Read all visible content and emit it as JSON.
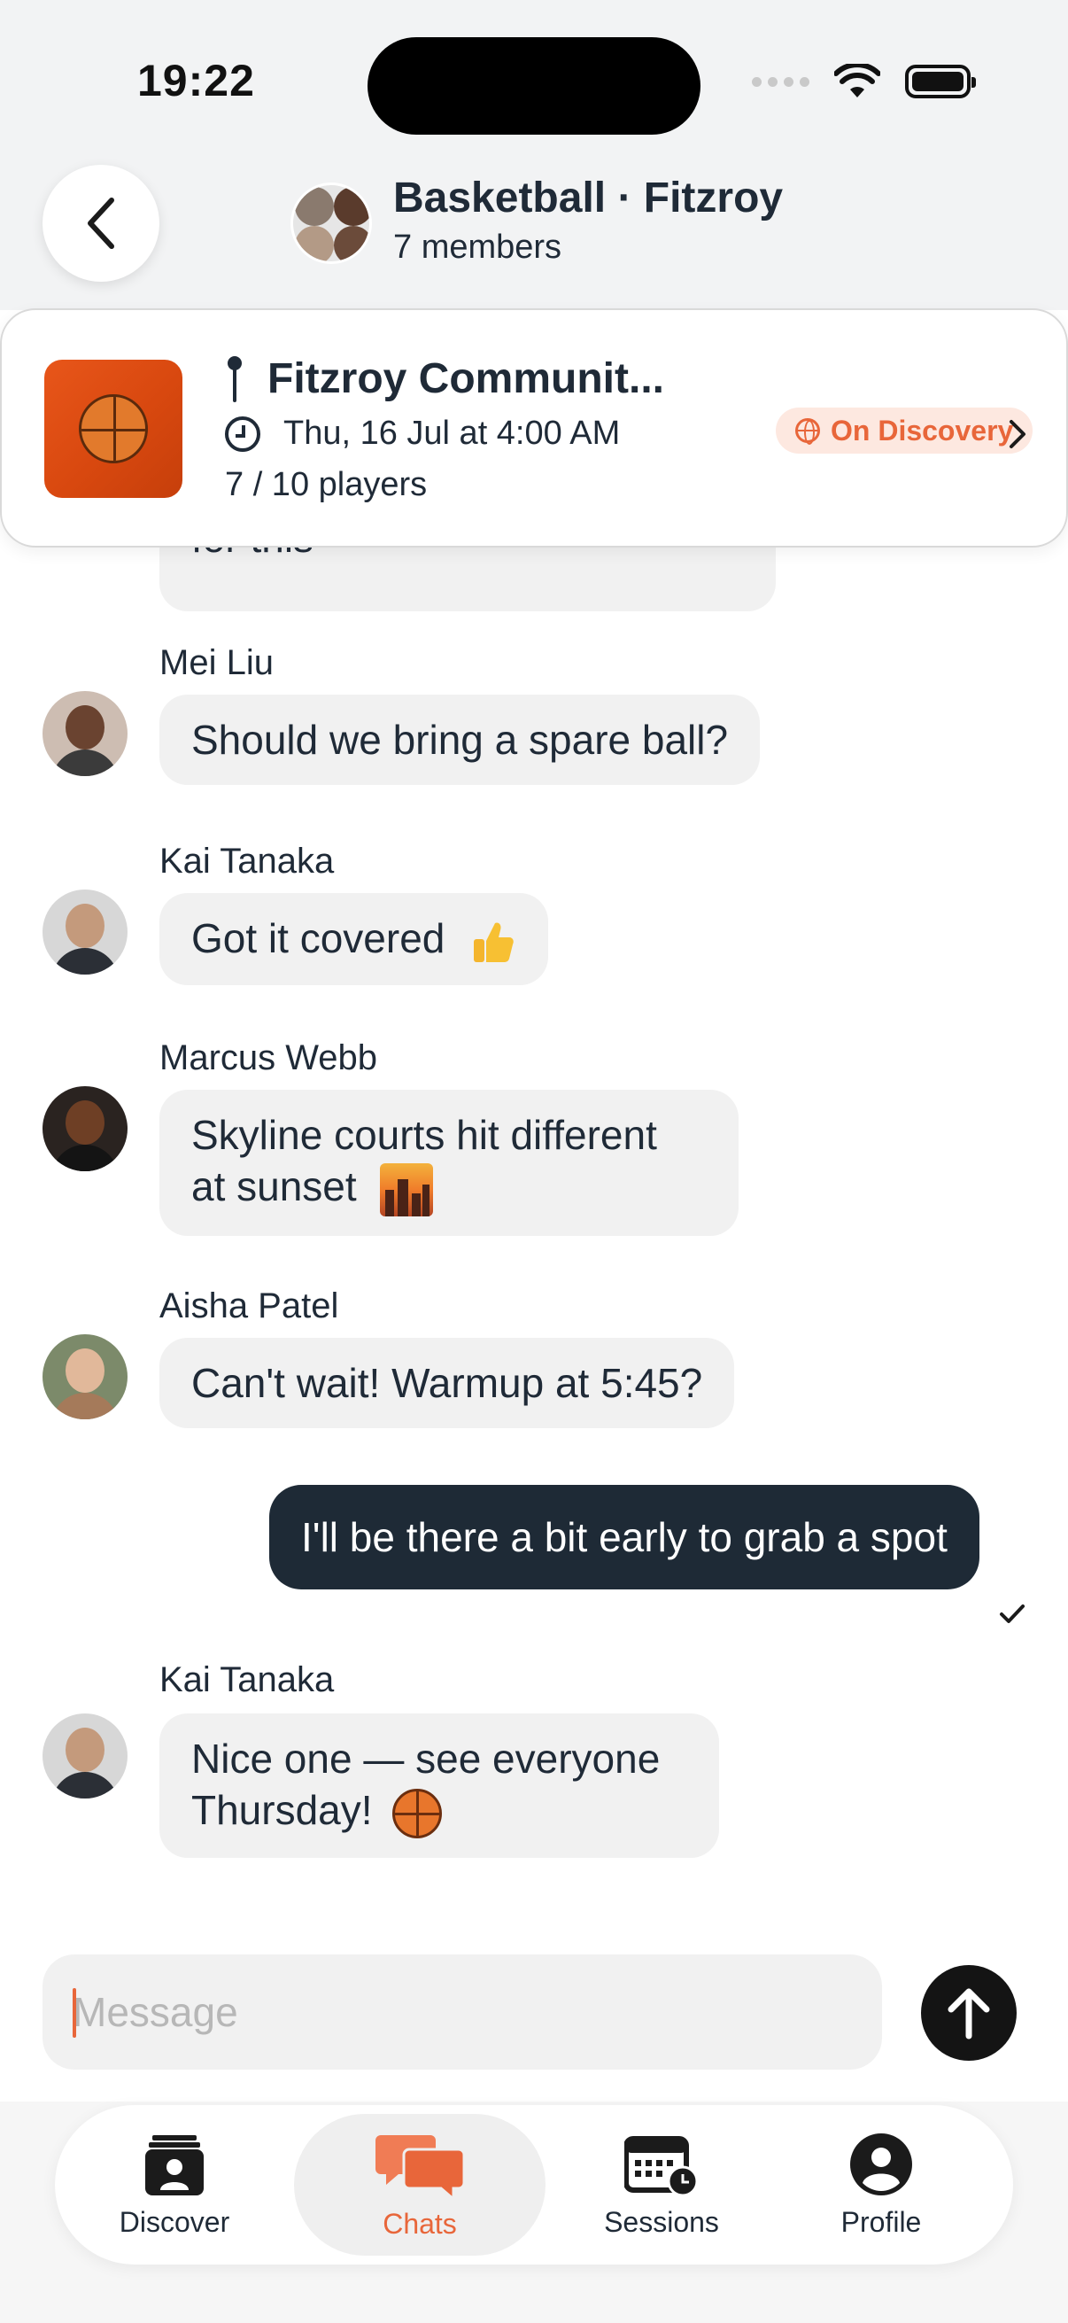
{
  "status_bar": {
    "time": "19:22"
  },
  "header": {
    "title": "Basketball · Fitzroy",
    "subtitle": "7 members"
  },
  "session_card": {
    "venue": "Fitzroy Communit...",
    "date": "Thu, 16 Jul at 4:00 AM",
    "players": "7 / 10 players",
    "badge": "On Discovery"
  },
  "messages": [
    {
      "sender": "",
      "text": "for this"
    },
    {
      "sender": "Mei Liu",
      "text": "Should we bring a spare ball?"
    },
    {
      "sender": "Kai Tanaka",
      "text": "Got it covered"
    },
    {
      "sender": "Marcus Webb",
      "line1": "Skyline courts hit different",
      "line2": "at sunset"
    },
    {
      "sender": "Aisha Patel",
      "text": "Can't wait! Warmup at 5:45?"
    },
    {
      "sender": "",
      "text": "I'll be there a bit early to grab a spot",
      "outgoing": true
    },
    {
      "sender": "Kai Tanaka",
      "line1": "Nice one — see everyone",
      "line2": "Thursday!"
    }
  ],
  "composer": {
    "placeholder": "Message"
  },
  "tabs": [
    {
      "label": "Discover",
      "icon": "discover-icon"
    },
    {
      "label": "Chats",
      "icon": "chats-icon",
      "active": true
    },
    {
      "label": "Sessions",
      "icon": "sessions-icon"
    },
    {
      "label": "Profile",
      "icon": "profile-icon"
    }
  ],
  "colors": {
    "accent": "#e8663a",
    "outgoing_bubble": "#1e2a36",
    "incoming_bubble": "#f1f1f1",
    "send_button": "#141414"
  }
}
